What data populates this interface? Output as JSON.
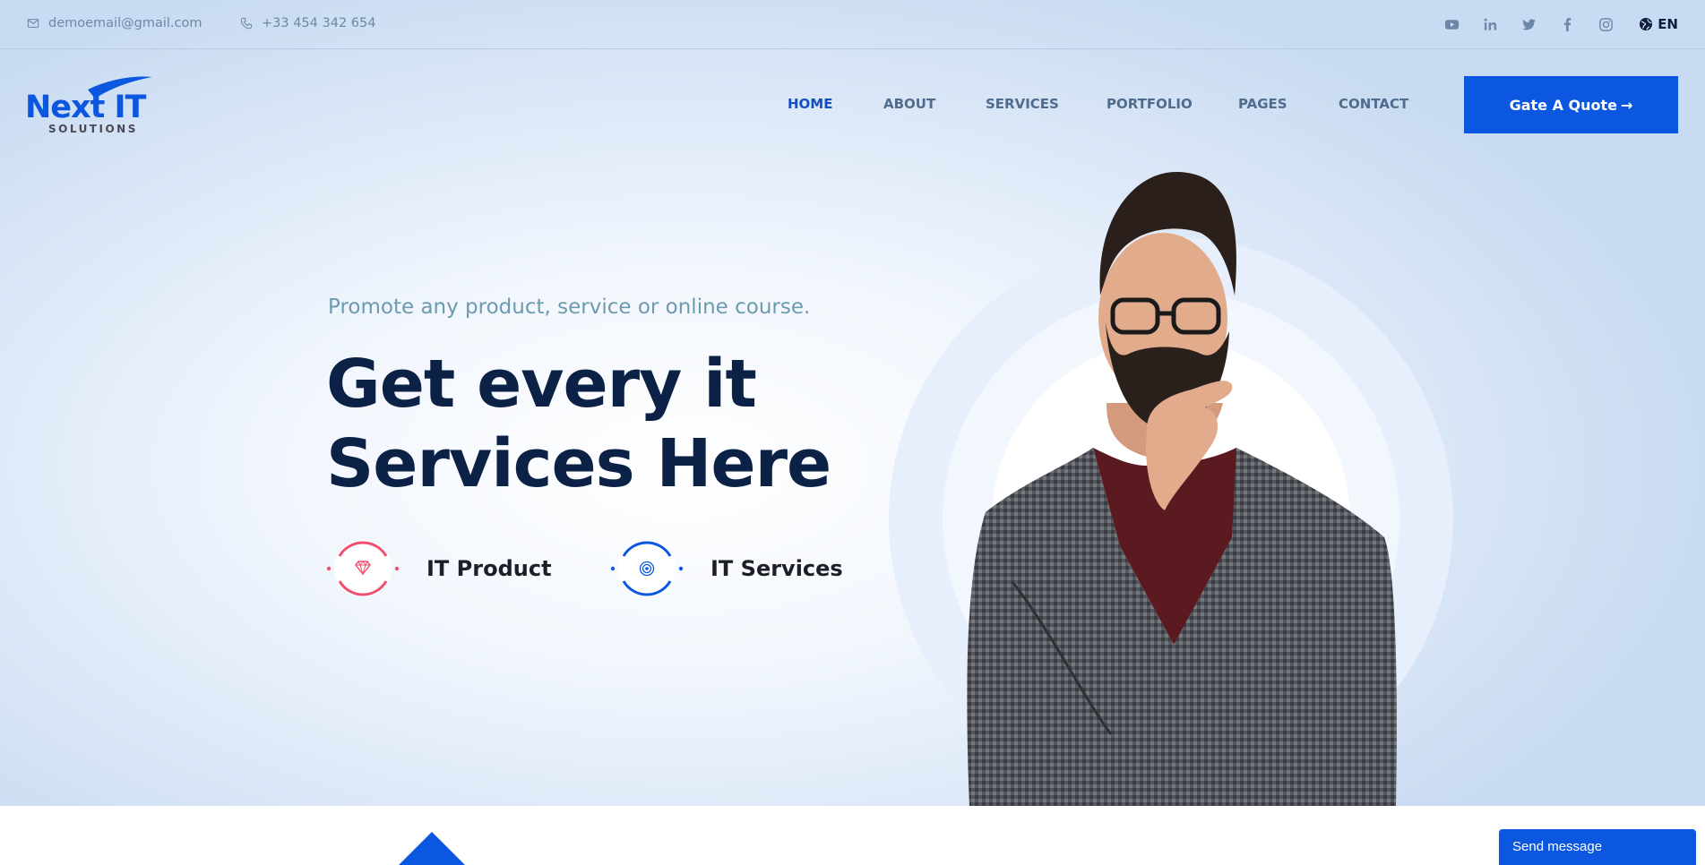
{
  "topbar": {
    "email": "demoemail@gmail.com",
    "phone": "+33 454 342 654",
    "socials": [
      "youtube-icon",
      "linkedin-icon",
      "twitter-icon",
      "facebook-icon",
      "instagram-icon"
    ],
    "language": "EN"
  },
  "logo": {
    "brand": "Next IT",
    "tagline": "SOLUTIONS"
  },
  "nav": {
    "items": [
      "HOME",
      "ABOUT",
      "SERVICES",
      "PORTFOLIO",
      "PAGES",
      "CONTACT"
    ],
    "active": "HOME"
  },
  "quote_button": {
    "label": "Gate A Quote",
    "arrow": "→"
  },
  "hero": {
    "eyebrow": "Promote any product, service or online course.",
    "headline_line1": "Get every it",
    "headline_line2": "Services Here",
    "features": [
      {
        "label": "IT Product",
        "icon": "diamond-icon",
        "color": "#f0506e"
      },
      {
        "label": "IT Services",
        "icon": "target-icon",
        "color": "#0b57e0"
      }
    ]
  },
  "colors": {
    "accent": "#0b57e0",
    "heading": "#0b2145",
    "nav_text": "#4f6c8c",
    "pink": "#f0506e"
  },
  "chat_widget": {
    "label": "Send message"
  }
}
